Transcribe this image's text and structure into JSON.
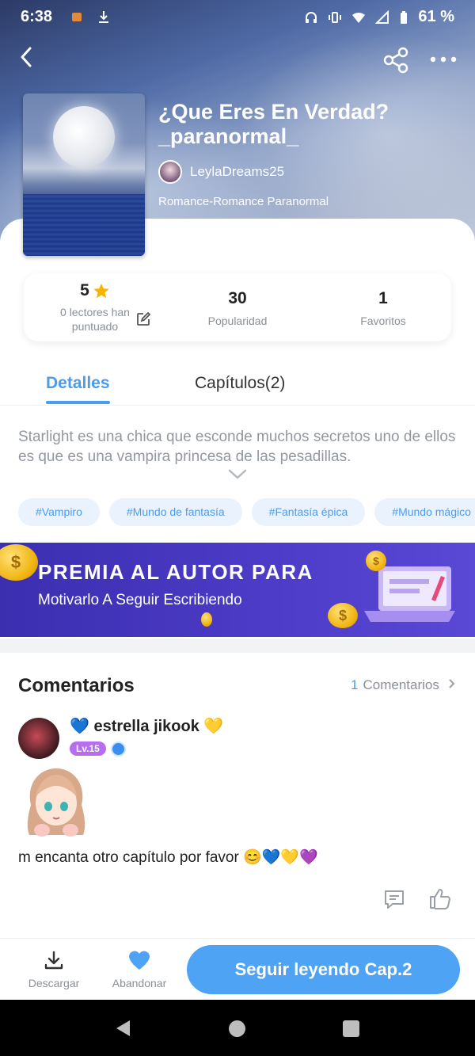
{
  "status_bar": {
    "time": "6:38",
    "battery": "61 %"
  },
  "book": {
    "title": "¿Que Eres En Verdad? _paranormal_",
    "author": "LeylaDreams25",
    "genre": "Romance-Romance Paranormal"
  },
  "stats": {
    "rating": "5",
    "rating_label": "0 lectores han puntuado",
    "popularity": "30",
    "popularity_label": "Popularidad",
    "favorites": "1",
    "favorites_label": "Favoritos"
  },
  "tabs": {
    "details": "Detalles",
    "chapters": "Capítulos(2)"
  },
  "description": "Starlight es una chica que esconde muchos secretos uno de ellos es que es una vampira princesa de las pesadillas.",
  "tags": [
    "#Vampiro",
    "#Mundo de fantasía",
    "#Fantasía épica",
    "#Mundo mágico"
  ],
  "banner": {
    "line1": "PREMIA AL AUTOR PARA",
    "line2": "Motivarlo A Seguir Escribiendo"
  },
  "comments": {
    "title": "Comentarios",
    "count": "1",
    "link_label": "Comentarios",
    "items": [
      {
        "user": "💙 estrella jikook 💛",
        "level": "Lv.15",
        "text": "m encanta otro capítulo por favor 😊💙💛💜"
      }
    ]
  },
  "bottom_bar": {
    "download": "Descargar",
    "abandon": "Abandonar",
    "continue": "Seguir leyendo Cap.2"
  },
  "colors": {
    "accent": "#4a9cf0",
    "banner": "#4a3ac4",
    "tag_bg": "#eaf3fd"
  }
}
